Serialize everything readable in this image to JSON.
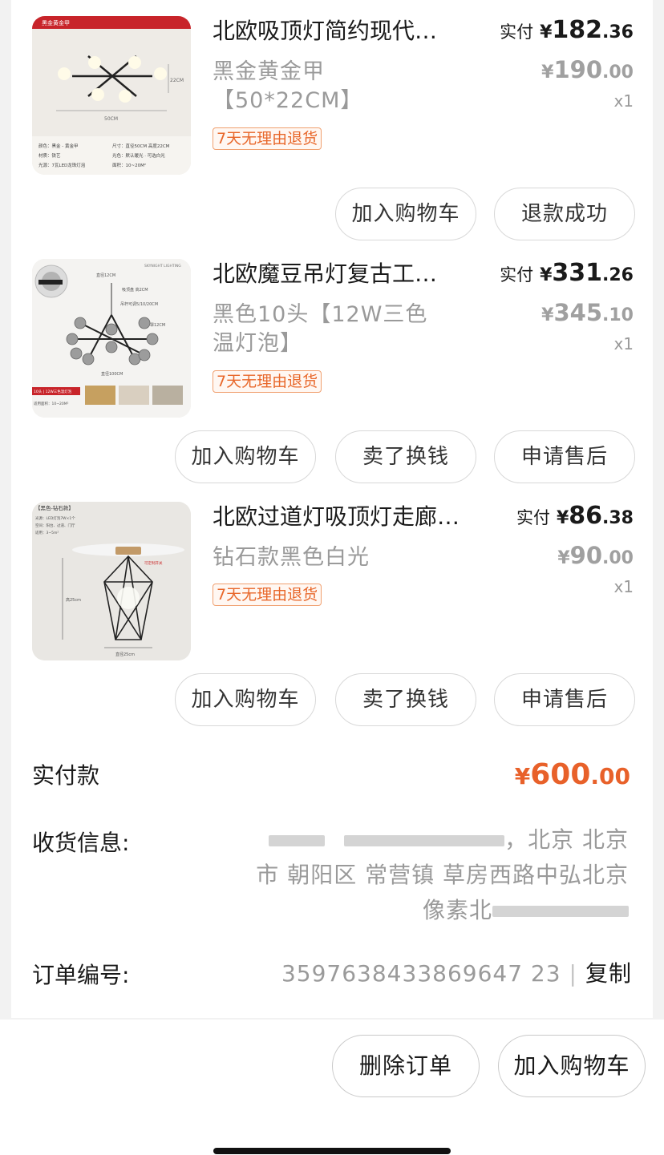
{
  "items": [
    {
      "title": "北欧吸顶灯简约现代…",
      "spec": "黑金黄金甲【50*22CM】",
      "tag": "7天无理由退货",
      "paid_label": "实付",
      "paid_yen": "¥",
      "paid_int": "182",
      "paid_dec": ".36",
      "orig_yen": "¥",
      "orig_int": "190",
      "orig_dec": ".00",
      "qty": "x1",
      "buttons": [
        "加入购物车",
        "退款成功"
      ]
    },
    {
      "title": "北欧魔豆吊灯复古工…",
      "spec": "黑色10头【12W三色温灯泡】",
      "tag": "7天无理由退货",
      "paid_label": "实付",
      "paid_yen": "¥",
      "paid_int": "331",
      "paid_dec": ".26",
      "orig_yen": "¥",
      "orig_int": "345",
      "orig_dec": ".10",
      "qty": "x1",
      "buttons": [
        "加入购物车",
        "卖了换钱",
        "申请售后"
      ]
    },
    {
      "title": "北欧过道灯吸顶灯走廊…",
      "spec": "钻石款黑色白光",
      "tag": "7天无理由退货",
      "paid_label": "实付",
      "paid_yen": "¥",
      "paid_int": "86",
      "paid_dec": ".38",
      "orig_yen": "¥",
      "orig_int": "90",
      "orig_dec": ".00",
      "qty": "x1",
      "buttons": [
        "加入购物车",
        "卖了换钱",
        "申请售后"
      ]
    }
  ],
  "thumb_text": {
    "item1": {
      "banner_left": "黑金黄金甲",
      "dim_height": "22CM",
      "dim_width": "50CM",
      "specs": [
        "颜色：黑金 - 黄金甲",
        "尺寸：直径50CM 高度22CM",
        "材质：铁艺",
        "光色：默认暖光 · 可选白光",
        "光源：7瓦LED龙珠灯泡",
        "面积：10~20M²"
      ]
    },
    "item2": {
      "header": "SKYNIGHT LIGHTING",
      "dims": [
        "直径12CM",
        "吸顶盘 高2CM",
        "吊杆可调5/10/20CM",
        "灯罩12CM",
        "直径100CM"
      ],
      "bottom": "10头 | 12W三色温灯泡",
      "area": "适用面积：10~20M²"
    },
    "item3": {
      "header": "【黑色-钻石款】",
      "specs": [
        "光源：LED灯泡7W×1个",
        "空间：阳台、过道、门厅",
        "适用：3~5m²"
      ],
      "height": "高25cm",
      "width": "直径25cm",
      "note": "可定制开关"
    }
  },
  "summary": {
    "total_label": "实付款",
    "total_yen": "¥",
    "total_int": "600",
    "total_dec": ".00",
    "address_label": "收货信息:",
    "address_line1_tail": "，北京 北京",
    "address_line2": "市 朝阳区 常营镇 草房西路中弘北京",
    "address_line3_head": "像素北",
    "order_label": "订单编号:",
    "order_number": "3597638433869647 23",
    "order_sep": "|",
    "copy_label": "复制"
  },
  "footer": {
    "delete_label": "删除订单",
    "cart_label": "加入购物车"
  },
  "colors": {
    "accent": "#e8612a",
    "tag_border": "#f0a070"
  }
}
